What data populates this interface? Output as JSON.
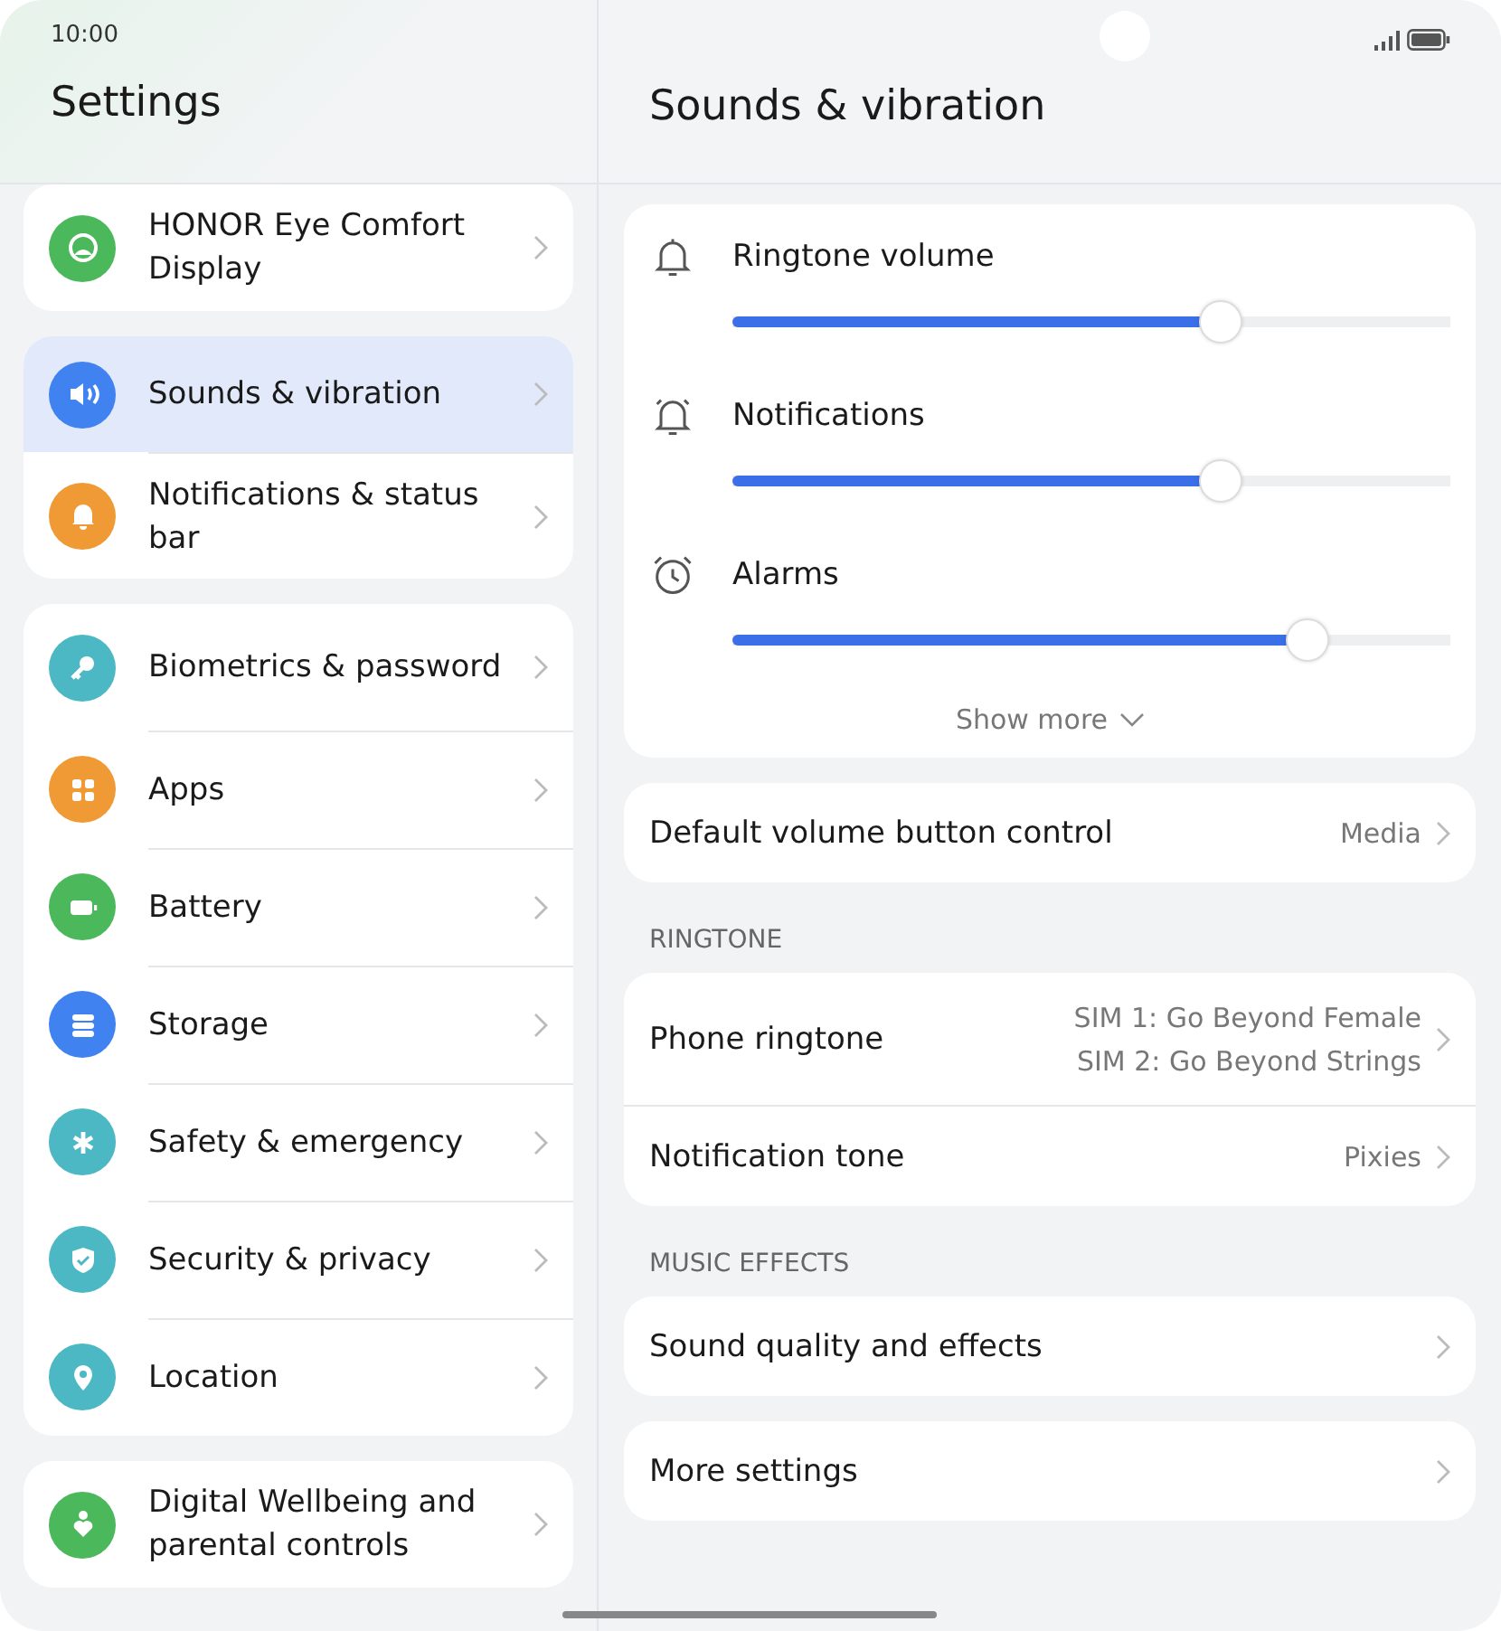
{
  "status_bar": {
    "time": "10:00"
  },
  "sidebar": {
    "title": "Settings",
    "groups": [
      {
        "items": [
          {
            "label": "HONOR Eye Comfort Display",
            "selected": false,
            "color": "#4cb85c"
          }
        ]
      },
      {
        "items": [
          {
            "label": "Sounds & vibration",
            "selected": true,
            "color": "#3f82f0"
          },
          {
            "label": "Notifications & status bar",
            "selected": false,
            "color": "#f09a35"
          }
        ]
      },
      {
        "items": [
          {
            "label": "Biometrics & password",
            "selected": false,
            "color": "#4cb8c4"
          },
          {
            "label": "Apps",
            "selected": false,
            "color": "#f09a35"
          },
          {
            "label": "Battery",
            "selected": false,
            "color": "#4cb85c"
          },
          {
            "label": "Storage",
            "selected": false,
            "color": "#3f82f0"
          },
          {
            "label": "Safety & emergency",
            "selected": false,
            "color": "#4cb8c4"
          },
          {
            "label": "Security & privacy",
            "selected": false,
            "color": "#4cb8c4"
          },
          {
            "label": "Location",
            "selected": false,
            "color": "#4cb8c4"
          }
        ]
      },
      {
        "items": [
          {
            "label": "Digital Wellbeing and parental controls",
            "selected": false,
            "color": "#4cb85c"
          }
        ]
      }
    ]
  },
  "detail": {
    "title": "Sounds & vibration",
    "volumes": [
      {
        "label": "Ringtone volume",
        "level": 0.68
      },
      {
        "label": "Notifications",
        "level": 0.68
      },
      {
        "label": "Alarms",
        "level": 0.8
      }
    ],
    "show_more": "Show more",
    "sections": [
      {
        "rows": [
          {
            "label": "Default volume button control",
            "values": [
              "Media"
            ]
          }
        ]
      },
      {
        "header": "RINGTONE",
        "rows": [
          {
            "label": "Phone ringtone",
            "values": [
              "SIM 1: Go Beyond Female",
              "SIM 2: Go Beyond Strings"
            ]
          },
          {
            "label": "Notification tone",
            "values": [
              "Pixies"
            ]
          }
        ]
      },
      {
        "header": "MUSIC EFFECTS",
        "rows": [
          {
            "label": "Sound quality and effects"
          }
        ]
      },
      {
        "rows": [
          {
            "label": "More settings"
          }
        ]
      }
    ]
  }
}
